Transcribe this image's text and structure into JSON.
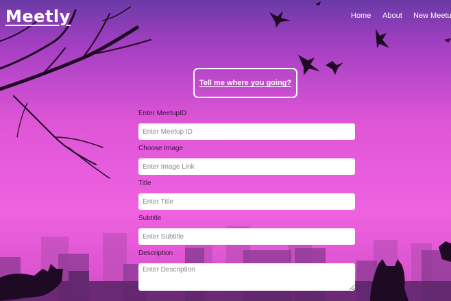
{
  "navbar": {
    "brand": "Meetly",
    "links": [
      "Home",
      "About",
      "New Meetup"
    ]
  },
  "hero": {
    "tagline": "Tell me where you going?"
  },
  "form": {
    "meetup_id_label": "Enter MeetupID",
    "meetup_id_placeholder": "Enter Meetup ID",
    "image_label": "Choose Image",
    "image_placeholder": "Enter Image Link",
    "title_label": "Title",
    "title_placeholder": "Enter Title",
    "subtitle_label": "Subtitle",
    "subtitle_placeholder": "Enter Subtitle",
    "description_label": "Description",
    "description_placeholder": "Enter Description"
  },
  "colors": {
    "accent": "#e05ad9",
    "text_dark": "#3a1040",
    "white": "#ffffff"
  }
}
